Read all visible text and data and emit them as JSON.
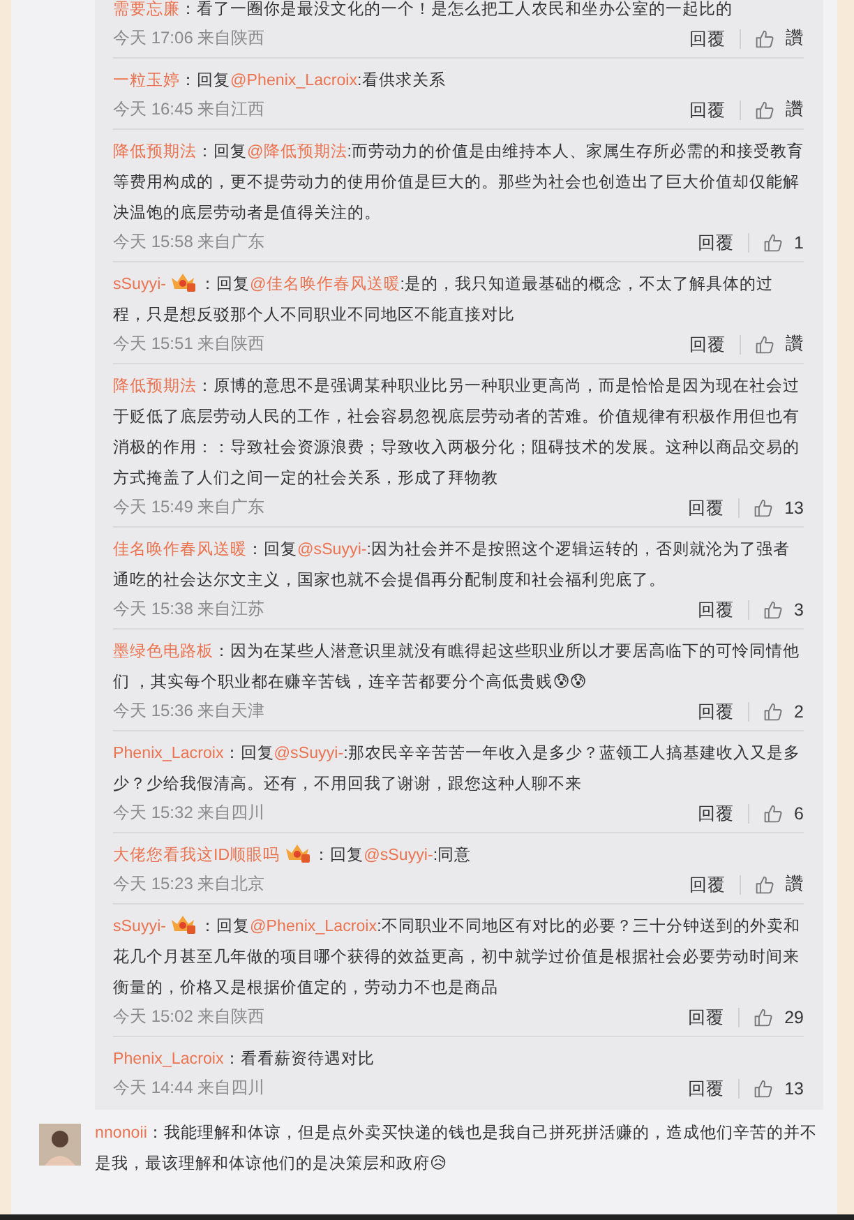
{
  "replies": [
    {
      "author": "需要忘廉",
      "badge": false,
      "segments": [
        {
          "kind": "plain",
          "text": "：看了一圈你是最没文化的一个！是怎么把工人农民和坐办公室的一起比的"
        }
      ],
      "time": "今天 17:06",
      "location": "来自陕西",
      "reply_label": "回覆",
      "likes": "讚"
    },
    {
      "author": "一粒玉婷",
      "badge": false,
      "segments": [
        {
          "kind": "plain",
          "text": "：回复"
        },
        {
          "kind": "mention",
          "text": "@Phenix_Lacroix"
        },
        {
          "kind": "plain",
          "text": ":看供求关系"
        }
      ],
      "time": "今天 16:45",
      "location": "来自江西",
      "reply_label": "回覆",
      "likes": "讚"
    },
    {
      "author": "降低预期法",
      "badge": false,
      "segments": [
        {
          "kind": "plain",
          "text": "：回复"
        },
        {
          "kind": "mention",
          "text": "@降低预期法"
        },
        {
          "kind": "plain",
          "text": ":而劳动力的价值是由维持本人、家属生存所必需的和接受教育等费用构成的，更不提劳动力的使用价值是巨大的。那些为社会也创造出了巨大价值却仅能解决温饱的底层劳动者是值得关注的。"
        }
      ],
      "time": "今天 15:58",
      "location": "来自广东",
      "reply_label": "回覆",
      "likes": "1"
    },
    {
      "author": "sSuyyi-",
      "badge": true,
      "segments": [
        {
          "kind": "plain",
          "text": "：回复"
        },
        {
          "kind": "mention",
          "text": "@佳名唤作春风送暖"
        },
        {
          "kind": "plain",
          "text": ":是的，我只知道最基础的概念，不太了解具体的过程，只是想反驳那个人不同职业不同地区不能直接对比"
        }
      ],
      "time": "今天 15:51",
      "location": "来自陕西",
      "reply_label": "回覆",
      "likes": "讚"
    },
    {
      "author": "降低预期法",
      "badge": false,
      "segments": [
        {
          "kind": "plain",
          "text": "：原博的意思不是强调某种职业比另一种职业更高尚，而是恰恰是因为现在社会过于贬低了底层劳动人民的工作，社会容易忽视底层劳动者的苦难。价值规律有积极作用但也有消极的作用：：导致社会资源浪费；导致收入两极分化；阻碍技术的发展。这种以商品交易的方式掩盖了人们之间一定的社会关系，形成了拜物教"
        }
      ],
      "time": "今天 15:49",
      "location": "来自广东",
      "reply_label": "回覆",
      "likes": "13"
    },
    {
      "author": "佳名唤作春风送暖",
      "badge": false,
      "segments": [
        {
          "kind": "plain",
          "text": "：回复"
        },
        {
          "kind": "mention",
          "text": "@sSuyyi-"
        },
        {
          "kind": "plain",
          "text": ":因为社会并不是按照这个逻辑运转的，否则就沦为了强者通吃的社会达尔文主义，国家也就不会提倡再分配制度和社会福利兜底了。"
        }
      ],
      "time": "今天 15:38",
      "location": "来自江苏",
      "reply_label": "回覆",
      "likes": "3"
    },
    {
      "author": "墨绿色电路板",
      "badge": false,
      "segments": [
        {
          "kind": "plain",
          "text": "：因为在某些人潜意识里就没有瞧得起这些职业所以才要居高临下的可怜同情他们 ，其实每个职业都在赚辛苦钱，连辛苦都要分个高低贵贱😰😰"
        }
      ],
      "time": "今天 15:36",
      "location": "来自天津",
      "reply_label": "回覆",
      "likes": "2"
    },
    {
      "author": "Phenix_Lacroix",
      "badge": false,
      "segments": [
        {
          "kind": "plain",
          "text": "：回复"
        },
        {
          "kind": "mention",
          "text": "@sSuyyi-"
        },
        {
          "kind": "plain",
          "text": ":那农民辛辛苦苦一年收入是多少？蓝领工人搞基建收入又是多少？少给我假清高。还有，不用回我了谢谢，跟您这种人聊不来"
        }
      ],
      "time": "今天 15:32",
      "location": "来自四川",
      "reply_label": "回覆",
      "likes": "6"
    },
    {
      "author": "大佬您看我这ID顺眼吗",
      "badge": true,
      "segments": [
        {
          "kind": "plain",
          "text": "：回复"
        },
        {
          "kind": "mention",
          "text": "@sSuyyi-"
        },
        {
          "kind": "plain",
          "text": ":同意"
        }
      ],
      "time": "今天 15:23",
      "location": "来自北京",
      "reply_label": "回覆",
      "likes": "讚"
    },
    {
      "author": "sSuyyi-",
      "badge": true,
      "segments": [
        {
          "kind": "plain",
          "text": "：回复"
        },
        {
          "kind": "mention",
          "text": "@Phenix_Lacroix"
        },
        {
          "kind": "plain",
          "text": ":不同职业不同地区有对比的必要？三十分钟送到的外卖和花几个月甚至几年做的项目哪个获得的效益更高，初中就学过价值是根据社会必要劳动时间来衡量的，价格又是根据价值定的，劳动力不也是商品"
        }
      ],
      "time": "今天 15:02",
      "location": "来自陕西",
      "reply_label": "回覆",
      "likes": "29"
    },
    {
      "author": "Phenix_Lacroix",
      "badge": false,
      "segments": [
        {
          "kind": "plain",
          "text": "：看看薪资待遇对比"
        }
      ],
      "time": "今天 14:44",
      "location": "来自四川",
      "reply_label": "回覆",
      "likes": "13"
    }
  ],
  "comment": {
    "author": "nnonoii",
    "segments": [
      {
        "kind": "plain",
        "text": "：我能理解和体谅，但是点外卖买快递的钱也是我自己拼死拼活赚的，造成他们辛苦的并不是我，最该理解和体谅他们的是决策层和政府😥"
      }
    ]
  }
}
